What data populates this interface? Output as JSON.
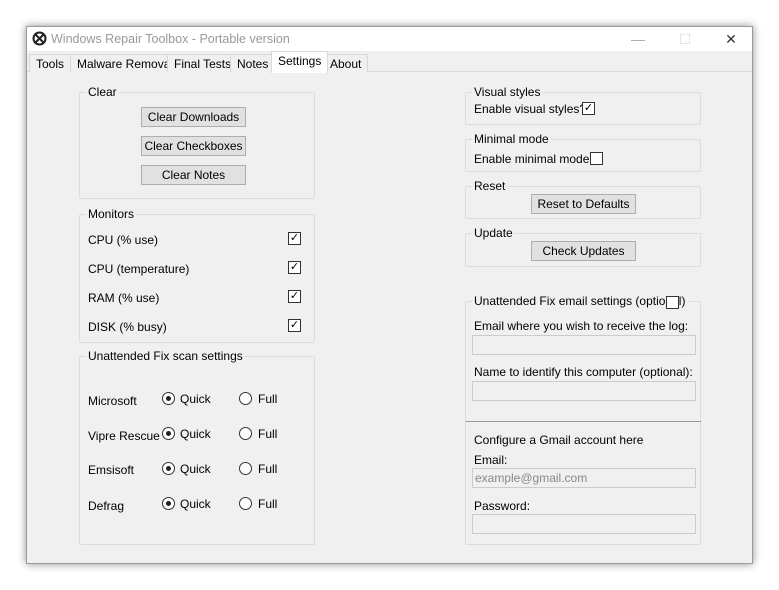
{
  "window": {
    "title": "Windows Repair Toolbox - Portable version",
    "minimize": "—",
    "maximize": "☐",
    "close": "✕"
  },
  "tabs": [
    {
      "label": "Tools"
    },
    {
      "label": "Malware Removal"
    },
    {
      "label": "Final Tests"
    },
    {
      "label": "Notes"
    },
    {
      "label": "Settings",
      "active": true
    },
    {
      "label": "About"
    }
  ],
  "clear": {
    "title": "Clear",
    "downloads": "Clear Downloads",
    "checkboxes": "Clear Checkboxes",
    "notes": "Clear Notes"
  },
  "monitors": {
    "title": "Monitors",
    "items": [
      {
        "label": "CPU (% use)",
        "checked": true
      },
      {
        "label": "CPU (temperature)",
        "checked": true
      },
      {
        "label": "RAM (% use)",
        "checked": true
      },
      {
        "label": "DISK (% busy)",
        "checked": true
      }
    ]
  },
  "scan": {
    "title": "Unattended Fix scan settings",
    "quick": "Quick",
    "full": "Full",
    "rows": [
      {
        "label": "Microsoft",
        "selected": "Quick"
      },
      {
        "label": "Vipre Rescue",
        "selected": "Quick"
      },
      {
        "label": "Emsisoft",
        "selected": "Quick"
      },
      {
        "label": "Defrag",
        "selected": "Quick"
      }
    ]
  },
  "visual": {
    "title": "Visual styles",
    "label": "Enable visual styles?",
    "checked": true
  },
  "minimal": {
    "title": "Minimal mode",
    "label": "Enable minimal mode?",
    "checked": false
  },
  "reset": {
    "title": "Reset",
    "button": "Reset to Defaults"
  },
  "update": {
    "title": "Update",
    "button": "Check Updates"
  },
  "email": {
    "title": "Unattended Fix email settings (optional)",
    "checked": false,
    "receive_label": "Email where you wish to receive the log:",
    "receive_value": "",
    "name_label": "Name to identify this computer (optional):",
    "name_value": "",
    "gmail_heading": "Configure a Gmail account here",
    "gmail_email_label": "Email:",
    "gmail_email_placeholder": "example@gmail.com",
    "password_label": "Password:",
    "password_value": ""
  }
}
